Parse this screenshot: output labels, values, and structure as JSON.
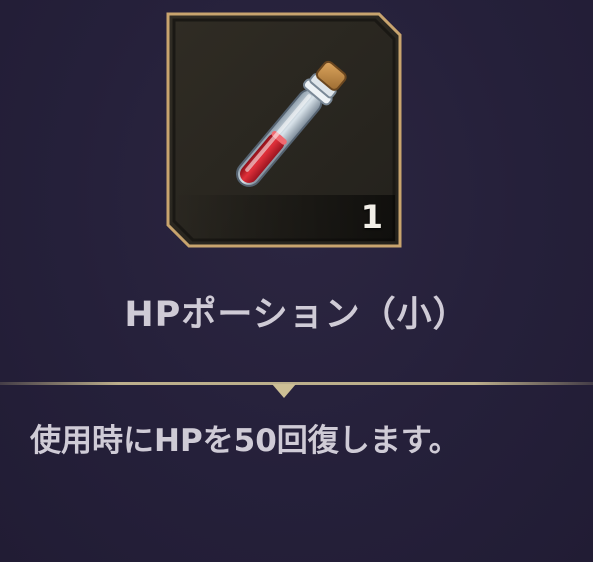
{
  "item": {
    "name": "HPポーション（小）",
    "quantity": "1",
    "description": "使用時にHPを50回復します。",
    "icon": "red-potion-vial-icon"
  },
  "colors": {
    "background": "#26213a",
    "frame_gold": "#c8a46e",
    "slot_fill": "#2a2720",
    "text": "#cfcbd6",
    "potion_red": "#d3202c"
  }
}
